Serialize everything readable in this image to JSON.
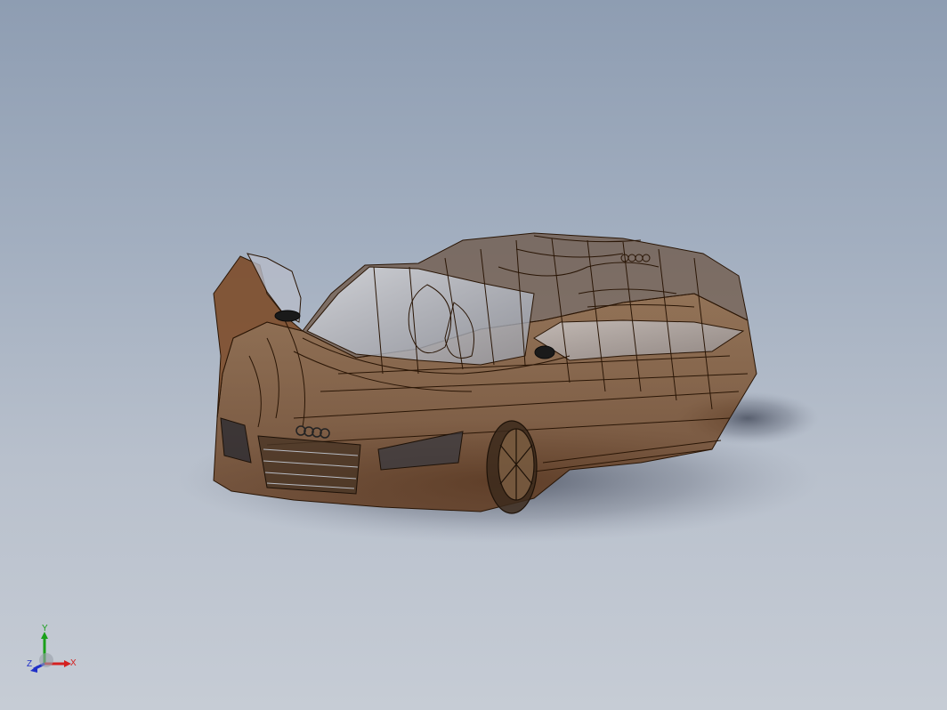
{
  "viewport": {
    "background_top": "#8e9db2",
    "background_bottom": "#c6ccd5",
    "model_color": "#6b3a14",
    "edge_color": "#2a1606",
    "display_mode": "transparent-wireframe"
  },
  "triad": {
    "x_label": "X",
    "y_label": "Y",
    "z_label": "Z",
    "x_color": "#d42020",
    "y_color": "#1aa01a",
    "z_color": "#2030c8"
  }
}
